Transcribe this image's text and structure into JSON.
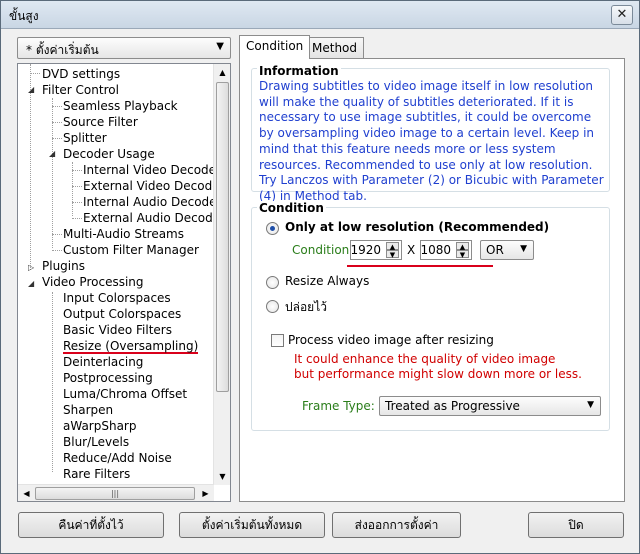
{
  "window": {
    "title": "ขั้นสูง",
    "close_icon": "close-icon"
  },
  "preset": {
    "value": "* ตั้งค่าเริ่มต้น"
  },
  "tree": {
    "items": [
      {
        "label": "DVD settings"
      },
      {
        "label": "Filter Control"
      },
      {
        "label": "Seamless Playback"
      },
      {
        "label": "Source Filter"
      },
      {
        "label": "Splitter"
      },
      {
        "label": "Decoder Usage"
      },
      {
        "label": "Internal Video Decoder"
      },
      {
        "label": "External Video Decoder"
      },
      {
        "label": "Internal Audio Decoder"
      },
      {
        "label": "External Audio Decoder"
      },
      {
        "label": "Multi-Audio Streams"
      },
      {
        "label": "Custom Filter Manager"
      },
      {
        "label": "Plugins"
      },
      {
        "label": "Video Processing"
      },
      {
        "label": "Input Colorspaces"
      },
      {
        "label": "Output Colorspaces"
      },
      {
        "label": "Basic Video Filters"
      },
      {
        "label": "Resize (Oversampling)"
      },
      {
        "label": "Deinterlacing"
      },
      {
        "label": "Postprocessing"
      },
      {
        "label": "Luma/Chroma Offset"
      },
      {
        "label": "Sharpen"
      },
      {
        "label": "aWarpSharp"
      },
      {
        "label": "Blur/Levels"
      },
      {
        "label": "Reduce/Add Noise"
      },
      {
        "label": "Rare Filters"
      }
    ],
    "selected": "Resize (Oversampling)"
  },
  "tabs": [
    {
      "label": "Condition"
    },
    {
      "label": "Method"
    }
  ],
  "active_tab": "Condition",
  "information": {
    "title": "Information",
    "text": "Drawing subtitles to video image itself in low resolution will make the quality of subtitles deteriorated. If it is necessary to use image subtitles, it could be overcome by oversampling video image to a certain level. Keep in mind that this feature needs more or less system resources. Recommended to use only at low resolution. Try Lanczos with Parameter (2) or Bicubic with Parameter (4) in Method tab."
  },
  "condition": {
    "title": "Condition",
    "option_low_res": "Only at low resolution (Recommended)",
    "condition_label": "Condition:",
    "width": "1920",
    "x_sep": "X",
    "height": "1080",
    "operator": "OR",
    "option_always": "Resize Always",
    "option_off": "ปล่อยไว้",
    "process_after_label": "Process video image after resizing",
    "warning_line1": "It could enhance the quality of video image",
    "warning_line2": "but performance might slow down more or less.",
    "frame_type_label": "Frame Type:",
    "frame_type_value": "Treated as Progressive",
    "selected_option": "Only at low resolution (Recommended)",
    "process_after_checked": false
  },
  "buttons": {
    "restore": "คืนค่าที่ตั้งไว้",
    "reset_all": "ตั้งค่าเริ่มต้นทั้งหมด",
    "export": "ส่งออกการตั้งค่า",
    "close": "ปิด"
  },
  "colors": {
    "info_text": "#1f3fcf",
    "green_label": "#2a7d1a",
    "warning": "#d00000",
    "annotation": "#d9001b"
  }
}
